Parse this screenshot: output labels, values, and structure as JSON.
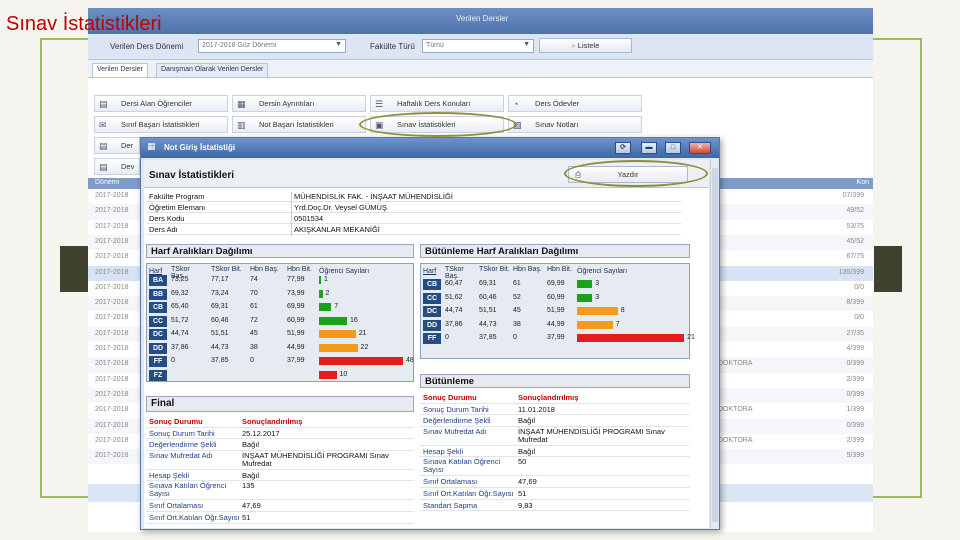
{
  "slide": {
    "title": "Sınav İstatistikleri"
  },
  "app": {
    "header_title": "Verilen Dersler",
    "filters": {
      "period_label": "Verilen Ders Dönemi",
      "period_value": "2017-2018 Güz Dönemi",
      "faculty_type_label": "Fakülte Türü",
      "faculty_type_value": "Tümü",
      "list_button": "Listele"
    },
    "tabs": [
      "Verilen Dersler",
      "Danışman Olarak Verilen Dersler"
    ],
    "action_buttons": [
      {
        "label": "Dersi Alan Öğrenciler",
        "icon": "students-icon"
      },
      {
        "label": "Dersin Ayrıntıları",
        "icon": "details-icon"
      },
      {
        "label": "Haftalık Ders Konuları",
        "icon": "list-icon"
      },
      {
        "label": "Ders Ödevler",
        "icon": "assignment-icon"
      },
      {
        "label": "Sınıf Başarı İstatistikleri",
        "icon": "stats-icon"
      },
      {
        "label": "Not Başarı İstatistikleri",
        "icon": "chart-icon"
      },
      {
        "label": "Sınav İstatistikleri",
        "icon": "exam-stats-icon"
      },
      {
        "label": "Sınav Notları",
        "icon": "notes-icon"
      }
    ],
    "partial_buttons": [
      "Der",
      "Dev"
    ],
    "bg_table": {
      "header_left": "Dönemi",
      "header_right": "Kon",
      "rows": [
        {
          "c1": "2017-2018",
          "c2": "",
          "c3": "07/399"
        },
        {
          "c1": "2017-2018",
          "c2": "",
          "c3": "49/52"
        },
        {
          "c1": "2017-2018",
          "c2": "",
          "c3": "53/75"
        },
        {
          "c1": "2017-2018",
          "c2": "",
          "c3": "45/52"
        },
        {
          "c1": "2017-2018",
          "c2": "",
          "c3": "67/75"
        },
        {
          "c1": "2017-2018",
          "c2": "",
          "c3": "135/399"
        },
        {
          "c1": "2017-2018",
          "c2": "",
          "c3": "0/0"
        },
        {
          "c1": "2017-2018",
          "c2": "",
          "c3": "8/399"
        },
        {
          "c1": "2017-2018",
          "c2": "",
          "c3": "0/0"
        },
        {
          "c1": "2017-2018",
          "c2": "",
          "c3": "27/35"
        },
        {
          "c1": "2017-2018",
          "c2": "",
          "c3": "4/399"
        },
        {
          "c1": "2017-2018",
          "c2": "DOKTORA",
          "c3": "0/399"
        },
        {
          "c1": "2017-2018",
          "c2": "",
          "c3": "2/399"
        },
        {
          "c1": "2017-2018",
          "c2": "",
          "c3": "0/399"
        },
        {
          "c1": "2017-2018",
          "c2": "DOKTORA",
          "c3": "1/399"
        },
        {
          "c1": "2017-2018",
          "c2": "",
          "c3": "0/399"
        },
        {
          "c1": "2017-2018",
          "c2": "DOKTORA",
          "c3": "2/399"
        },
        {
          "c1": "2017-2018",
          "c2": "",
          "c3": "5/399"
        }
      ]
    }
  },
  "dialog": {
    "title": "Not Giriş İstatistiği",
    "stats_title": "Sınav İstatistikleri",
    "print_button": "Yazdır",
    "info": [
      {
        "k": "Fakülte Program",
        "v": "MÜHENDİSLİK FAK. - İNŞAAT MÜHENDİSLİĞİ"
      },
      {
        "k": "Öğretim Elemanı",
        "v": "Yrd.Doç.Dr. Veysel GÜMÜŞ"
      },
      {
        "k": "Ders Kodu",
        "v": "0501534"
      },
      {
        "k": "Ders Adı",
        "v": "AKIŞKANLAR MEKANİĞİ"
      }
    ],
    "grade_panel": {
      "title": "Harf Aralıkları Dağılımı",
      "headers": [
        "Harf",
        "TSkor Baş.",
        "TSkor Bit.",
        "Hbn Baş.",
        "Hbn Bit.",
        "Öğrenci Sayıları"
      ],
      "rows": [
        {
          "letter": "BA",
          "ts_start": "73,25",
          "ts_end": "77,17",
          "hbn_start": "74",
          "hbn_end": "77,99",
          "count": 1,
          "color": "#1aa31a"
        },
        {
          "letter": "BB",
          "ts_start": "69,32",
          "ts_end": "73,24",
          "hbn_start": "70",
          "hbn_end": "73,99",
          "count": 2,
          "color": "#1aa31a"
        },
        {
          "letter": "CB",
          "ts_start": "65,40",
          "ts_end": "69,31",
          "hbn_start": "61",
          "hbn_end": "69,99",
          "count": 7,
          "color": "#1aa31a"
        },
        {
          "letter": "CC",
          "ts_start": "51,72",
          "ts_end": "60,46",
          "hbn_start": "72",
          "hbn_end": "60,99",
          "count": 16,
          "color": "#1aa31a"
        },
        {
          "letter": "DC",
          "ts_start": "44,74",
          "ts_end": "51,51",
          "hbn_start": "45",
          "hbn_end": "51,99",
          "count": 21,
          "color": "#f39a1c"
        },
        {
          "letter": "DD",
          "ts_start": "37,86",
          "ts_end": "44,73",
          "hbn_start": "38",
          "hbn_end": "44,99",
          "count": 22,
          "color": "#f39a1c"
        },
        {
          "letter": "FF",
          "ts_start": "0",
          "ts_end": "37,85",
          "hbn_start": "0",
          "hbn_end": "37,99",
          "count": 48,
          "color": "#e51c1c"
        },
        {
          "letter": "FZ",
          "ts_start": "",
          "ts_end": "",
          "hbn_start": "",
          "hbn_end": "",
          "count": 10,
          "color": "#e51c1c"
        }
      ]
    },
    "makeup_panel": {
      "title": "Bütünleme Harf Aralıkları Dağılımı",
      "headers": [
        "Harf",
        "TSkor Baş.",
        "TSkor Bit.",
        "Hbn Baş.",
        "Hbn Bit.",
        "Öğrenci Sayıları"
      ],
      "rows": [
        {
          "letter": "CB",
          "ts_start": "60,47",
          "ts_end": "69,31",
          "hbn_start": "61",
          "hbn_end": "69,99",
          "count": 3,
          "color": "#1aa31a"
        },
        {
          "letter": "CC",
          "ts_start": "51,62",
          "ts_end": "60,46",
          "hbn_start": "52",
          "hbn_end": "60,99",
          "count": 3,
          "color": "#1aa31a"
        },
        {
          "letter": "DC",
          "ts_start": "44,74",
          "ts_end": "51,51",
          "hbn_start": "45",
          "hbn_end": "51,99",
          "count": 8,
          "color": "#f39a1c"
        },
        {
          "letter": "DD",
          "ts_start": "37,86",
          "ts_end": "44,73",
          "hbn_start": "38",
          "hbn_end": "44,99",
          "count": 7,
          "color": "#f39a1c"
        },
        {
          "letter": "FF",
          "ts_start": "0",
          "ts_end": "37,85",
          "hbn_start": "0",
          "hbn_end": "37,99",
          "count": 21,
          "color": "#e51c1c"
        }
      ]
    },
    "final_panel": {
      "title": "Final",
      "rows": [
        {
          "k": "Sonuç Durumu",
          "v": "Sonuçlandırılmış",
          "red": true
        },
        {
          "k": "Sonuç Durum Tarihi",
          "v": "25.12.2017"
        },
        {
          "k": "Değerlendirme Şekli",
          "v": "Bağıl"
        },
        {
          "k": "Sınav Mufredat Adı",
          "v": "İNŞAAT MÜHENDİSLİĞİ PROGRAMI Sınav Mufredat",
          "two": true
        },
        {
          "k": "Hesap Şekli",
          "v": "Bağıl"
        },
        {
          "k": "Sınava Katılan Öğrenci Sayısı",
          "v": "135",
          "two": true
        },
        {
          "k": "Sınıf Ortalaması",
          "v": "47,69"
        },
        {
          "k": "Sınıf Ort.Katılan Öğr.Sayısı",
          "v": "51"
        }
      ]
    },
    "makeup_exam_panel": {
      "title": "Bütünleme",
      "rows": [
        {
          "k": "Sonuç Durumu",
          "v": "Sonuçlandırılmış",
          "red": true
        },
        {
          "k": "Sonuç Durum Tarihi",
          "v": "11.01.2018"
        },
        {
          "k": "Değerlendirme Şekli",
          "v": "Bağıl"
        },
        {
          "k": "Sınav Mufredat Adı",
          "v": "İNŞAAT MÜHENDİSLİĞİ PROGRAMI Sınav Mufredat",
          "two": true
        },
        {
          "k": "Hesap Şekli",
          "v": "Bağıl"
        },
        {
          "k": "Sınava Katılan Öğrenci Sayısı",
          "v": "50",
          "two": true
        },
        {
          "k": "Sınıf Ortalaması",
          "v": "47,69"
        },
        {
          "k": "Sınıf Ort.Katılan Öğr.Sayısı",
          "v": "51"
        },
        {
          "k": "Standart Sapma",
          "v": "9,83"
        }
      ]
    }
  }
}
